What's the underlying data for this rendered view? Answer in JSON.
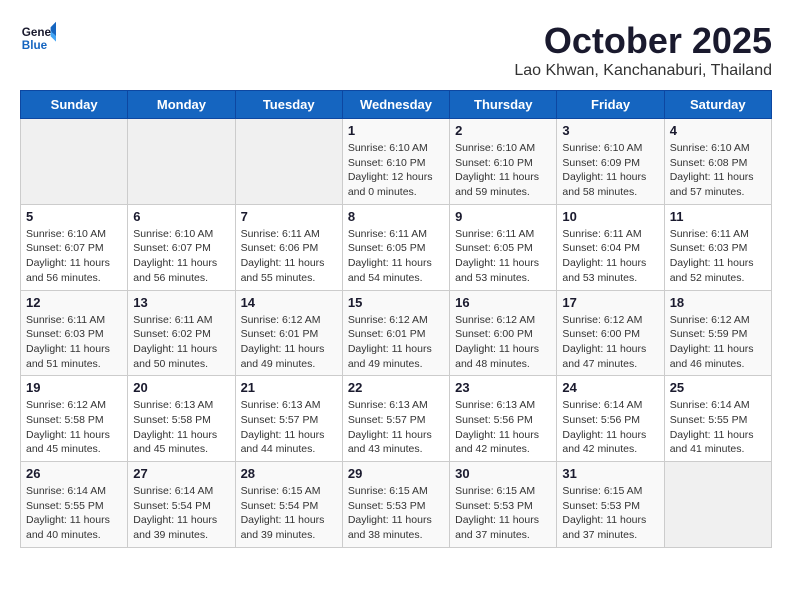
{
  "logo": {
    "general": "General",
    "blue": "Blue"
  },
  "title": "October 2025",
  "subtitle": "Lao Khwan, Kanchanaburi, Thailand",
  "days_of_week": [
    "Sunday",
    "Monday",
    "Tuesday",
    "Wednesday",
    "Thursday",
    "Friday",
    "Saturday"
  ],
  "weeks": [
    [
      {
        "day": "",
        "info": ""
      },
      {
        "day": "",
        "info": ""
      },
      {
        "day": "",
        "info": ""
      },
      {
        "day": "1",
        "info": "Sunrise: 6:10 AM\nSunset: 6:10 PM\nDaylight: 12 hours\nand 0 minutes."
      },
      {
        "day": "2",
        "info": "Sunrise: 6:10 AM\nSunset: 6:10 PM\nDaylight: 11 hours\nand 59 minutes."
      },
      {
        "day": "3",
        "info": "Sunrise: 6:10 AM\nSunset: 6:09 PM\nDaylight: 11 hours\nand 58 minutes."
      },
      {
        "day": "4",
        "info": "Sunrise: 6:10 AM\nSunset: 6:08 PM\nDaylight: 11 hours\nand 57 minutes."
      }
    ],
    [
      {
        "day": "5",
        "info": "Sunrise: 6:10 AM\nSunset: 6:07 PM\nDaylight: 11 hours\nand 56 minutes."
      },
      {
        "day": "6",
        "info": "Sunrise: 6:10 AM\nSunset: 6:07 PM\nDaylight: 11 hours\nand 56 minutes."
      },
      {
        "day": "7",
        "info": "Sunrise: 6:11 AM\nSunset: 6:06 PM\nDaylight: 11 hours\nand 55 minutes."
      },
      {
        "day": "8",
        "info": "Sunrise: 6:11 AM\nSunset: 6:05 PM\nDaylight: 11 hours\nand 54 minutes."
      },
      {
        "day": "9",
        "info": "Sunrise: 6:11 AM\nSunset: 6:05 PM\nDaylight: 11 hours\nand 53 minutes."
      },
      {
        "day": "10",
        "info": "Sunrise: 6:11 AM\nSunset: 6:04 PM\nDaylight: 11 hours\nand 53 minutes."
      },
      {
        "day": "11",
        "info": "Sunrise: 6:11 AM\nSunset: 6:03 PM\nDaylight: 11 hours\nand 52 minutes."
      }
    ],
    [
      {
        "day": "12",
        "info": "Sunrise: 6:11 AM\nSunset: 6:03 PM\nDaylight: 11 hours\nand 51 minutes."
      },
      {
        "day": "13",
        "info": "Sunrise: 6:11 AM\nSunset: 6:02 PM\nDaylight: 11 hours\nand 50 minutes."
      },
      {
        "day": "14",
        "info": "Sunrise: 6:12 AM\nSunset: 6:01 PM\nDaylight: 11 hours\nand 49 minutes."
      },
      {
        "day": "15",
        "info": "Sunrise: 6:12 AM\nSunset: 6:01 PM\nDaylight: 11 hours\nand 49 minutes."
      },
      {
        "day": "16",
        "info": "Sunrise: 6:12 AM\nSunset: 6:00 PM\nDaylight: 11 hours\nand 48 minutes."
      },
      {
        "day": "17",
        "info": "Sunrise: 6:12 AM\nSunset: 6:00 PM\nDaylight: 11 hours\nand 47 minutes."
      },
      {
        "day": "18",
        "info": "Sunrise: 6:12 AM\nSunset: 5:59 PM\nDaylight: 11 hours\nand 46 minutes."
      }
    ],
    [
      {
        "day": "19",
        "info": "Sunrise: 6:12 AM\nSunset: 5:58 PM\nDaylight: 11 hours\nand 45 minutes."
      },
      {
        "day": "20",
        "info": "Sunrise: 6:13 AM\nSunset: 5:58 PM\nDaylight: 11 hours\nand 45 minutes."
      },
      {
        "day": "21",
        "info": "Sunrise: 6:13 AM\nSunset: 5:57 PM\nDaylight: 11 hours\nand 44 minutes."
      },
      {
        "day": "22",
        "info": "Sunrise: 6:13 AM\nSunset: 5:57 PM\nDaylight: 11 hours\nand 43 minutes."
      },
      {
        "day": "23",
        "info": "Sunrise: 6:13 AM\nSunset: 5:56 PM\nDaylight: 11 hours\nand 42 minutes."
      },
      {
        "day": "24",
        "info": "Sunrise: 6:14 AM\nSunset: 5:56 PM\nDaylight: 11 hours\nand 42 minutes."
      },
      {
        "day": "25",
        "info": "Sunrise: 6:14 AM\nSunset: 5:55 PM\nDaylight: 11 hours\nand 41 minutes."
      }
    ],
    [
      {
        "day": "26",
        "info": "Sunrise: 6:14 AM\nSunset: 5:55 PM\nDaylight: 11 hours\nand 40 minutes."
      },
      {
        "day": "27",
        "info": "Sunrise: 6:14 AM\nSunset: 5:54 PM\nDaylight: 11 hours\nand 39 minutes."
      },
      {
        "day": "28",
        "info": "Sunrise: 6:15 AM\nSunset: 5:54 PM\nDaylight: 11 hours\nand 39 minutes."
      },
      {
        "day": "29",
        "info": "Sunrise: 6:15 AM\nSunset: 5:53 PM\nDaylight: 11 hours\nand 38 minutes."
      },
      {
        "day": "30",
        "info": "Sunrise: 6:15 AM\nSunset: 5:53 PM\nDaylight: 11 hours\nand 37 minutes."
      },
      {
        "day": "31",
        "info": "Sunrise: 6:15 AM\nSunset: 5:53 PM\nDaylight: 11 hours\nand 37 minutes."
      },
      {
        "day": "",
        "info": ""
      }
    ]
  ]
}
